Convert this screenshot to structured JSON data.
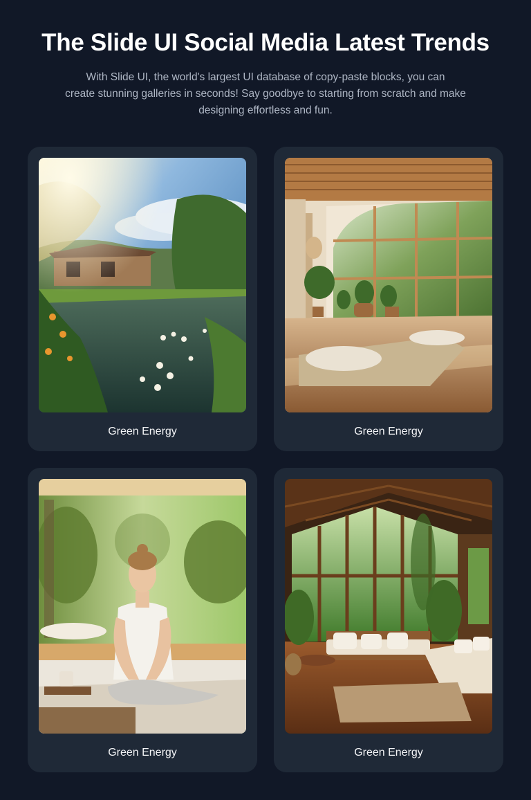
{
  "header": {
    "title": "The Slide UI Social Media Latest Trends",
    "subtitle_lines": [
      "With Slide UI, the world's largest UI database of copy-paste blocks, you can",
      "create stunning galleries in seconds! Say goodbye to starting from scratch and make",
      "designing effortless and fun."
    ]
  },
  "gallery": {
    "cards": [
      {
        "caption": "Green Energy",
        "image": "garden-pond-cabin-photo"
      },
      {
        "caption": "Green Energy",
        "image": "sunlit-wooden-room-photo"
      },
      {
        "caption": "Green Energy",
        "image": "woman-meditating-photo"
      },
      {
        "caption": "Green Energy",
        "image": "forest-cabin-lounge-photo"
      }
    ]
  },
  "colors": {
    "background": "#111827",
    "card": "#1f2937",
    "text": "#ffffff",
    "muted_text": "#aeb6c4"
  }
}
